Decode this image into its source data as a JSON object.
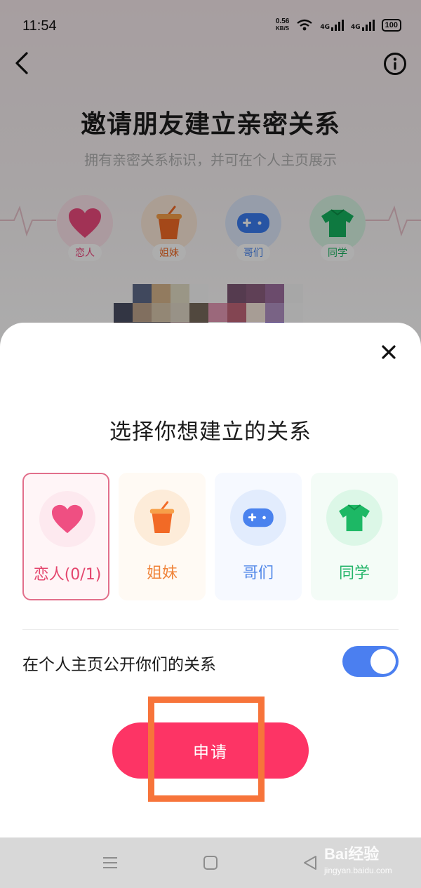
{
  "status_bar": {
    "time": "11:54",
    "net_speed_value": "0.56",
    "net_speed_unit": "KB/S",
    "signal1_label": "4G",
    "signal2_label": "4G",
    "battery": "100"
  },
  "header": {
    "title": "邀请朋友建立亲密关系",
    "subtitle": "拥有亲密关系标识，并可在个人主页展示"
  },
  "background_relations": [
    {
      "label": "恋人",
      "color": "#ee3f78"
    },
    {
      "label": "姐妹",
      "color": "#f26a26"
    },
    {
      "label": "哥们",
      "color": "#3a7cf0"
    },
    {
      "label": "同学",
      "color": "#15b35f"
    }
  ],
  "sheet": {
    "title": "选择你想建立的关系",
    "options": [
      {
        "label": "恋人(0/1)",
        "color": "#e4456d",
        "selected": true
      },
      {
        "label": "姐妹",
        "color": "#f0843a",
        "selected": false
      },
      {
        "label": "哥们",
        "color": "#4f86e8",
        "selected": false
      },
      {
        "label": "同学",
        "color": "#25b56a",
        "selected": false
      }
    ],
    "public_toggle_label": "在个人主页公开你们的关系",
    "public_toggle_on": true,
    "apply_label": "申请"
  },
  "watermark": {
    "logo_text": "Bai经验",
    "url": "jingyan.baidu.com"
  },
  "colors": {
    "accent": "#fd3465",
    "toggle_on": "#4b7ff0",
    "highlight": "#f7743a"
  }
}
